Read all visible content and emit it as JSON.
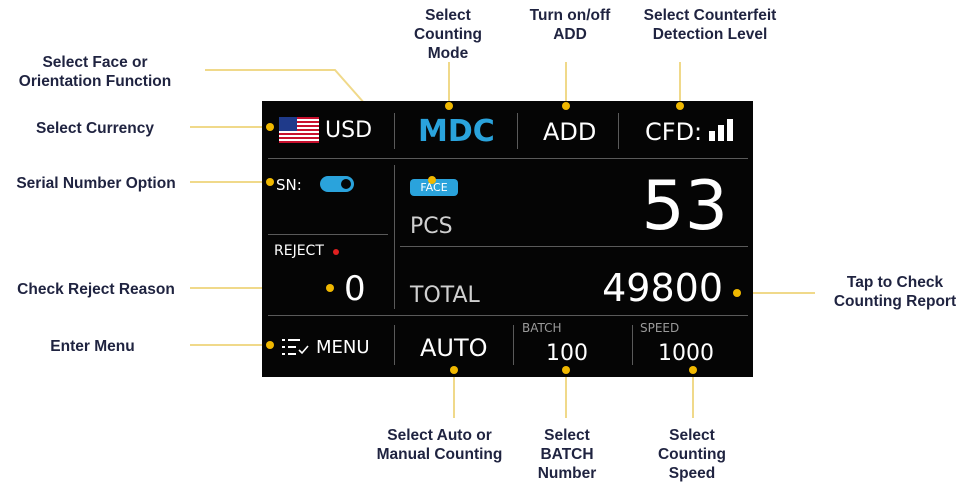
{
  "annotations": {
    "select_counting_mode": "Select\nCounting\nMode",
    "turn_on_off_add": "Turn on/off\nADD",
    "select_counterfeit_level": "Select Counterfeit\nDetection Level",
    "select_face_orientation": "Select Face or\nOrientation Function",
    "select_currency": "Select  Currency",
    "serial_number_option": "Serial Number Option",
    "check_reject_reason": "Check Reject Reason",
    "enter_menu": "Enter Menu",
    "tap_counting_report": "Tap to Check\nCounting Report",
    "select_auto_manual": "Select Auto or\nManual Counting",
    "select_batch_number": "Select\nBATCH\nNumber",
    "select_counting_speed": "Select\nCounting\nSpeed"
  },
  "screen": {
    "currency": "USD",
    "mode": "MDC",
    "add": "ADD",
    "cfd_label": "CFD:",
    "sn_label": "SN:",
    "sn_enabled": true,
    "face_badge": "FACE",
    "pcs_label": "PCS",
    "pcs_value": "53",
    "reject_label": "REJECT",
    "reject_value": "0",
    "total_label": "TOTAL",
    "total_value": "49800",
    "menu_label": "MENU",
    "auto_label": "AUTO",
    "batch_label": "BATCH",
    "batch_value": "100",
    "speed_label": "SPEED",
    "speed_value": "1000",
    "cfd_level_bars": 3
  },
  "colors": {
    "accent_blue": "#2aa3dc",
    "pointer_gold": "#f0b800",
    "reject_dot": "#e02020",
    "label_text": "#1f2340",
    "screen_bg": "#050505"
  },
  "icons": [
    "us-flag-icon",
    "signal-bars-icon",
    "menu-list-icon",
    "toggle-switch-icon"
  ]
}
